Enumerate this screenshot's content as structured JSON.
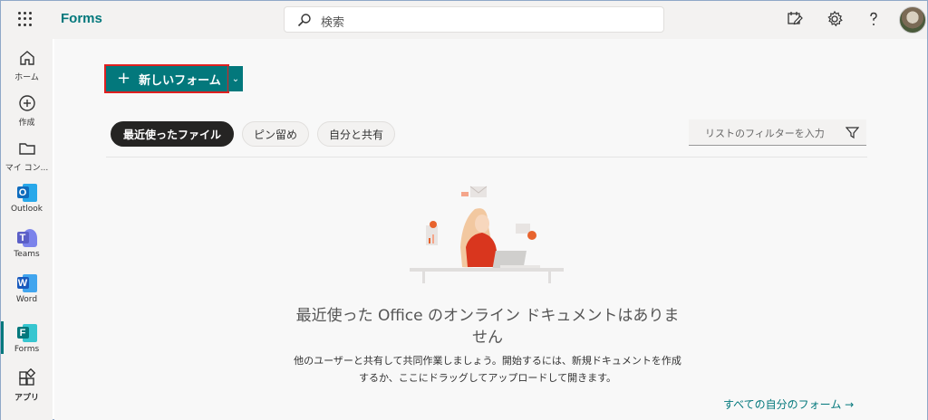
{
  "header": {
    "app_name": "Forms",
    "search_placeholder": "検索"
  },
  "rail": {
    "items": [
      {
        "label": "ホーム",
        "icon": "home-icon"
      },
      {
        "label": "作成",
        "icon": "create-icon"
      },
      {
        "label": "マイ コン...",
        "icon": "folder-icon"
      },
      {
        "label": "Outlook",
        "icon": "outlook-icon",
        "letter": "O",
        "color": "#0f6cbd"
      },
      {
        "label": "Teams",
        "icon": "teams-icon",
        "letter": "T",
        "color": "#5b5fc7"
      },
      {
        "label": "Word",
        "icon": "word-icon",
        "letter": "W",
        "color": "#185abd"
      },
      {
        "label": "Forms",
        "icon": "forms-icon",
        "letter": "F",
        "color": "#03787c"
      },
      {
        "label": "アプリ",
        "icon": "apps-icon"
      }
    ]
  },
  "main": {
    "new_form_label": "新しいフォーム",
    "tabs": [
      {
        "label": "最近使ったファイル",
        "active": true
      },
      {
        "label": "ピン留め",
        "active": false
      },
      {
        "label": "自分と共有",
        "active": false
      }
    ],
    "filter_placeholder": "リストのフィルターを入力",
    "empty_title": "最近使った Office のオンライン ドキュメントはありません",
    "empty_subtitle": "他のユーザーと共有して共同作業しましょう。開始するには、新規ドキュメントを作成するか、ここにドラッグしてアップロードして開きます。",
    "all_forms_link": "すべての自分のフォーム →"
  },
  "colors": {
    "accent": "#03787c",
    "highlight": "#e02020"
  }
}
